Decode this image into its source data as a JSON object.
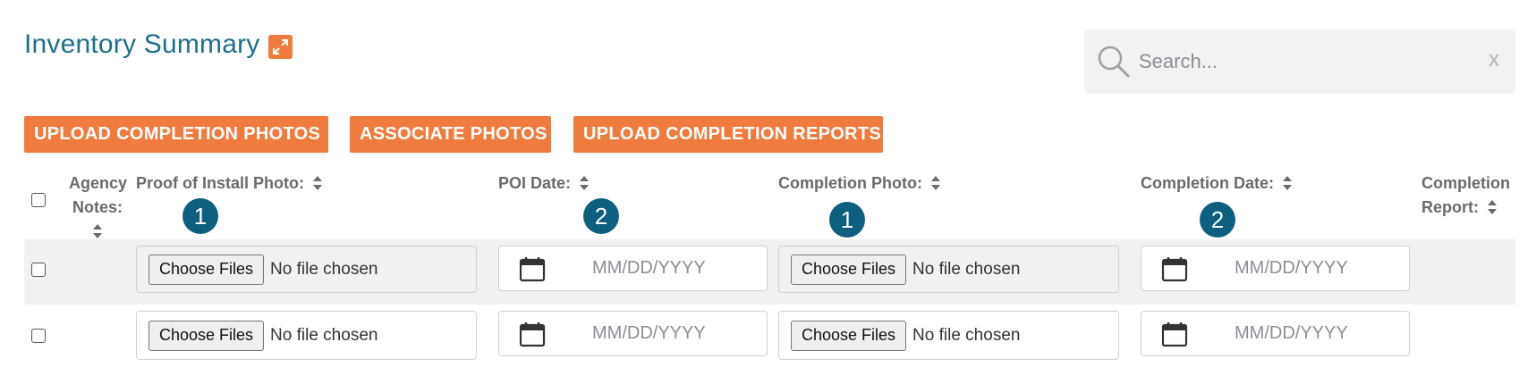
{
  "header": {
    "title": "Inventory Summary",
    "expand_icon": "expand-arrows-icon"
  },
  "search": {
    "placeholder": "Search...",
    "clear_label": "x",
    "icon": "search-icon"
  },
  "actions": {
    "upload_photos": "UPLOAD COMPLETION PHOTOS",
    "associate_photos": "ASSOCIATE PHOTOS",
    "upload_reports": "UPLOAD COMPLETION REPORTS"
  },
  "table": {
    "columns": {
      "agency_notes_1": "Agency",
      "agency_notes_2": "Notes:",
      "proof_of_install": "Proof of Install Photo:",
      "poi_date": "POI Date:",
      "completion_photo": "Completion Photo:",
      "completion_date": "Completion Date:",
      "completion_report_1": "Completion",
      "completion_report_2": "Report:"
    },
    "badges": {
      "proof_of_install": "1",
      "poi_date": "2",
      "completion_photo": "1",
      "completion_date": "2"
    },
    "rows": [
      {
        "choose_label_1": "Choose Files",
        "no_file_1": "No file chosen",
        "date_placeholder_1": "MM/DD/YYYY",
        "choose_label_2": "Choose Files",
        "no_file_2": "No file chosen",
        "date_placeholder_2": "MM/DD/YYYY"
      },
      {
        "choose_label_1": "Choose Files",
        "no_file_1": "No file chosen",
        "date_placeholder_1": "MM/DD/YYYY",
        "choose_label_2": "Choose Files",
        "no_file_2": "No file chosen",
        "date_placeholder_2": "MM/DD/YYYY"
      }
    ]
  },
  "colors": {
    "accent_orange": "#f07b3f",
    "title_blue": "#1f6f8b",
    "badge_blue": "#0d5e7f",
    "row_shade": "#f1f1f1"
  }
}
